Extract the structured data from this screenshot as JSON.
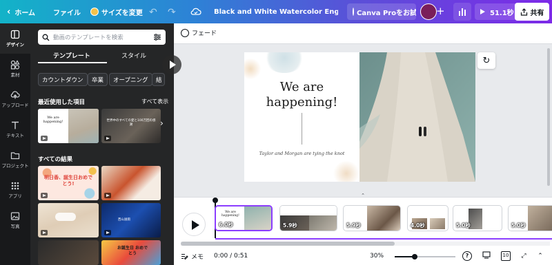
{
  "topbar": {
    "home_label": "ホーム",
    "file_label": "ファイル",
    "resize_label": "サイズを変更",
    "undo_icon": "undo-icon",
    "redo_icon": "redo-icon",
    "cloud_icon": "cloud-saved-icon",
    "doc_title": "Black and White Watercolor Engagement A...",
    "pro_label": "Canva Proをお試し...",
    "avatar_color": "#7a1e5a",
    "present_duration": "51.1秒",
    "share_label": "共有"
  },
  "rail": {
    "items": [
      {
        "label": "デザイン",
        "icon": "design-icon",
        "active": true
      },
      {
        "label": "素材",
        "icon": "elements-icon",
        "active": false
      },
      {
        "label": "アップロード",
        "icon": "upload-icon",
        "active": false
      },
      {
        "label": "テキスト",
        "icon": "text-icon",
        "active": false
      },
      {
        "label": "プロジェクト",
        "icon": "folder-icon",
        "active": false
      },
      {
        "label": "アプリ",
        "icon": "apps-icon",
        "active": false
      },
      {
        "label": "写真",
        "icon": "photo-icon",
        "active": false
      }
    ]
  },
  "panel": {
    "search_placeholder": "動画のテンプレートを検索",
    "tabs": [
      {
        "label": "テンプレート",
        "active": true
      },
      {
        "label": "スタイル",
        "active": false
      }
    ],
    "chips": [
      "カウントダウン",
      "卒業",
      "オープニング",
      "結"
    ],
    "recent_title": "最近使用した項目",
    "show_all": "すべて表示",
    "recent_thumbs": [
      {
        "text": "We are happening!"
      },
      {
        "text": "世界中のすべての愛と100万回の感謝"
      }
    ],
    "results_title": "すべての結果",
    "result_thumbs": [
      {
        "text": "明日香、誕生日おめでとう!"
      },
      {
        "text": ""
      },
      {
        "text": ""
      },
      {
        "text": "西山滋雨"
      },
      {
        "text": ""
      },
      {
        "text": "お誕生日 おめでとう"
      }
    ]
  },
  "toolbar": {
    "fade_label": "フェード"
  },
  "slide": {
    "title_line1": "We are",
    "title_line2": "happening!",
    "subtitle": "Taylor and Morgan are tying the knot"
  },
  "timeline": {
    "clips": [
      {
        "duration": "6.0秒",
        "active": true
      },
      {
        "duration": "5.9秒",
        "active": false
      },
      {
        "duration": "5.9秒",
        "active": false
      },
      {
        "duration": "4.0秒",
        "active": false
      },
      {
        "duration": "5.0秒",
        "active": false
      },
      {
        "duration": "5.0秒",
        "active": false
      }
    ]
  },
  "bottombar": {
    "memo_label": "メモ",
    "time": "0:00 / 0:51",
    "zoom": "30%",
    "zoom_level": 0.33,
    "page_count": "10",
    "help_label": "?"
  },
  "colors": {
    "accent": "#8b3dff",
    "gradient_start": "#13b3c8",
    "gradient_end": "#7d2ae8",
    "panel_bg": "#252627",
    "rail_bg": "#18191b"
  }
}
